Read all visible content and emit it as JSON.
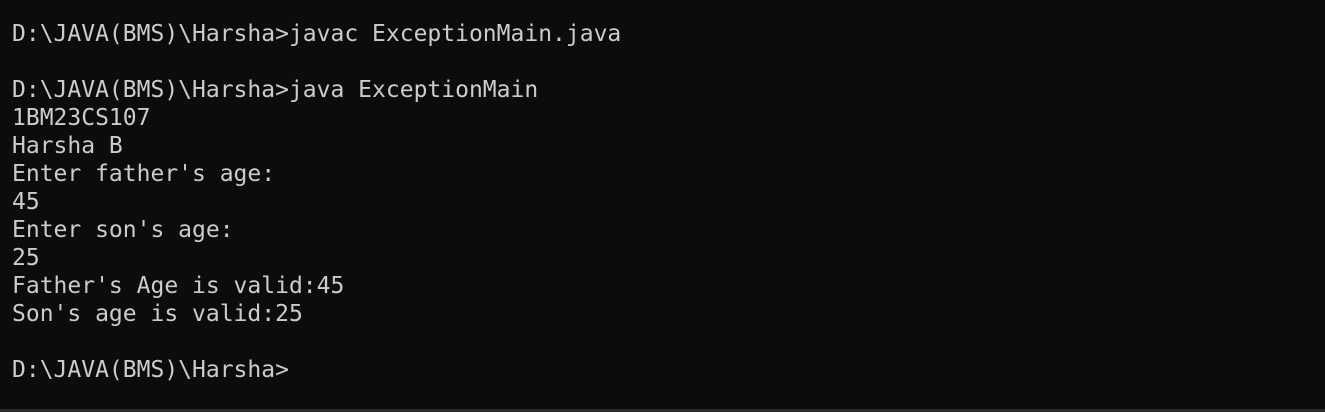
{
  "terminal": {
    "lines": [
      "D:\\JAVA(BMS)\\Harsha>javac ExceptionMain.java",
      "",
      "D:\\JAVA(BMS)\\Harsha>java ExceptionMain",
      "1BM23CS107",
      "Harsha B",
      "Enter father's age:",
      "45",
      "Enter son's age:",
      "25",
      "Father's Age is valid:45",
      "Son's age is valid:25",
      "",
      "D:\\JAVA(BMS)\\Harsha>"
    ]
  },
  "colors": {
    "background": "#0c0c0c",
    "foreground": "#cccccc"
  }
}
